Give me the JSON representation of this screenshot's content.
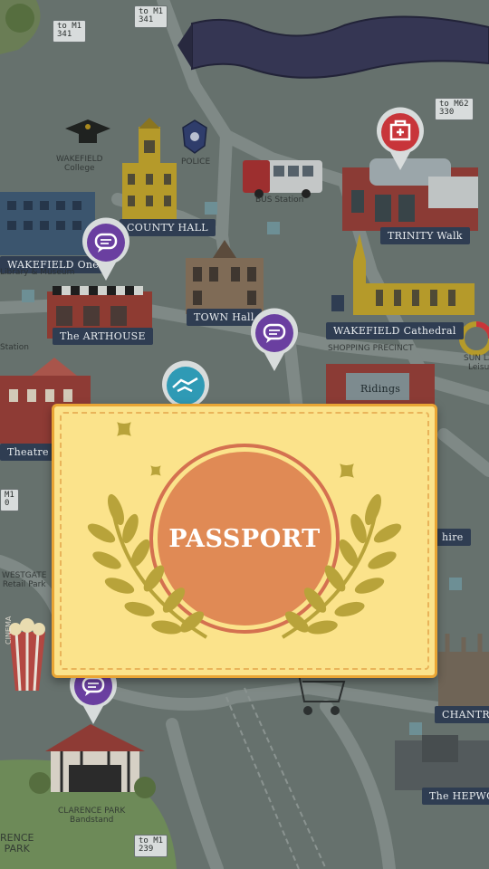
{
  "map": {
    "labels": {
      "county_hall": "COUNTY HALL",
      "wakefield_one": "WAKEFIELD One",
      "wakefield_one_sub": "Library & Museum",
      "arthouse": "The ARTHOUSE",
      "town_hall": "TOWN Hall",
      "cathedral": "WAKEFIELD Cathedral",
      "trinity_walk": "TRINITY Walk",
      "theatre": "Theatre",
      "ridings": "Ridings",
      "chantry": "CHANTRY",
      "hepworth": "The HEPWO",
      "shire": "hire"
    },
    "captions": {
      "college": "WAKEFIELD\nCollege",
      "police": "POLICE",
      "bus_station": "BUS Station",
      "bandstand": "CLARENCE PARK\nBandstand",
      "westgate": "WESTGATE\nRetail Park",
      "shopping": "SHOPPING PRECINCT",
      "cinema": "CINEMA",
      "sun_lane": "SUN LA\nLeisu",
      "rence_park": "RENCE\nPARK",
      "station": "Station"
    },
    "signs": {
      "m1_top": "to M1\n341",
      "m1_left": "to M1\n341",
      "m62": "to M62\n330",
      "m1_mid": "M1\n0",
      "m1_bottom": "to M1\n239"
    },
    "colors": {
      "pin_purple": "#6a3fa0",
      "pin_red": "#c8353a",
      "pin_teal": "#2f9ab5",
      "label_bg": "#2f3d52"
    }
  },
  "passport": {
    "title": "PASSPORT",
    "colors": {
      "card": "#fbe38b",
      "border": "#e9a534",
      "emblem": "#e08a55",
      "emblem_ring": "#d47150",
      "leaves": "#b8a33a"
    }
  }
}
